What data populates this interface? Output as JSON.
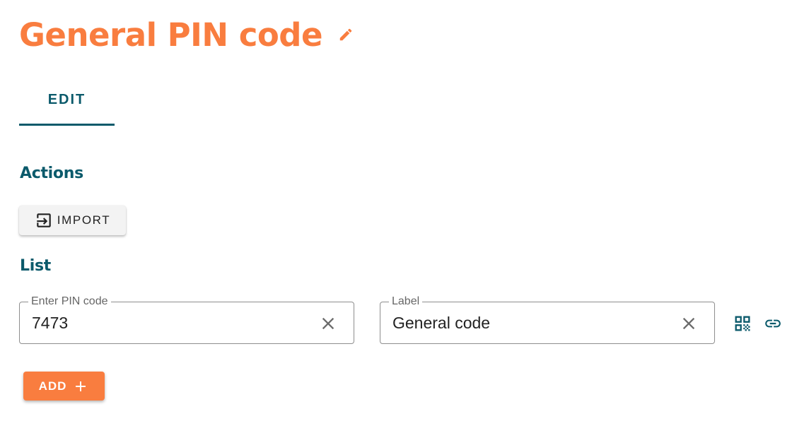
{
  "header": {
    "title": "General PIN code",
    "edit_icon": "pencil-icon",
    "accent_color": "#f97d3f"
  },
  "tabs": [
    {
      "label": "EDIT",
      "active": true
    }
  ],
  "actions": {
    "heading": "Actions",
    "import_label": "IMPORT",
    "import_icon": "import-icon"
  },
  "list": {
    "heading": "List",
    "entries": [
      {
        "pin_legend": "Enter PIN code",
        "pin_value": "7473",
        "label_legend": "Label",
        "label_value": "General code"
      }
    ],
    "clear_icon": "close-icon",
    "qr_icon": "qr-code-icon",
    "link_icon": "link-icon"
  },
  "add_button": {
    "label": "ADD",
    "icon": "plus-icon"
  },
  "colors": {
    "primary_teal": "#0b5a6b",
    "accent_orange": "#f97d3f"
  }
}
